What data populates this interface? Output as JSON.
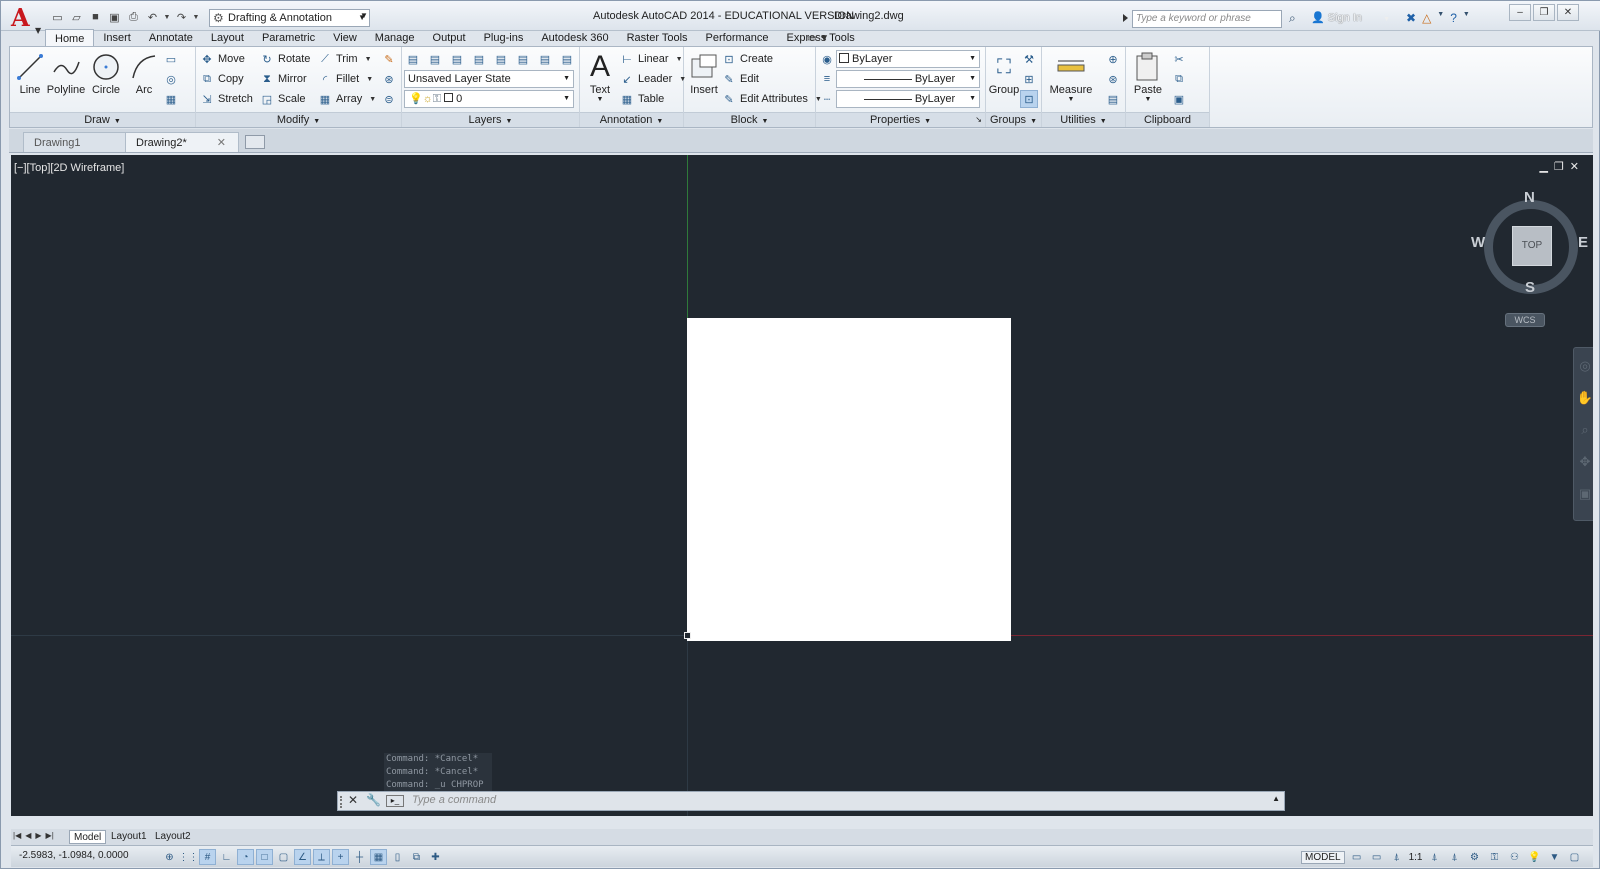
{
  "titlebar": {
    "title": "Autodesk AutoCAD 2014 - EDUCATIONAL VERSION",
    "filename": "Drawing2.dwg",
    "workspace": "Drafting & Annotation",
    "search_placeholder": "Type a keyword or phrase",
    "sign_in": "Sign In"
  },
  "ribbon_tabs": [
    "Home",
    "Insert",
    "Annotate",
    "Layout",
    "Parametric",
    "View",
    "Manage",
    "Output",
    "Plug-ins",
    "Autodesk 360",
    "Raster Tools",
    "Performance",
    "Express Tools"
  ],
  "active_tab": "Home",
  "panels": {
    "draw": {
      "title": "Draw",
      "buttons": [
        "Line",
        "Polyline",
        "Circle",
        "Arc"
      ]
    },
    "modify": {
      "title": "Modify",
      "rows": [
        [
          "Move",
          "Rotate",
          "Trim"
        ],
        [
          "Copy",
          "Mirror",
          "Fillet"
        ],
        [
          "Stretch",
          "Scale",
          "Array"
        ]
      ]
    },
    "layers": {
      "title": "Layers",
      "layer_state": "Unsaved Layer State",
      "current_layer": "0"
    },
    "annotation": {
      "title": "Annotation",
      "text_button": "Text",
      "items": [
        "Linear",
        "Leader",
        "Table"
      ]
    },
    "block": {
      "title": "Block",
      "insert_button": "Insert",
      "items": [
        "Create",
        "Edit",
        "Edit Attributes"
      ]
    },
    "properties": {
      "title": "Properties",
      "color": "ByLayer",
      "linetype": "ByLayer",
      "lineweight": "ByLayer"
    },
    "groups": {
      "title": "Groups",
      "button": "Group"
    },
    "utilities": {
      "title": "Utilities",
      "button": "Measure"
    },
    "clipboard": {
      "title": "Clipboard",
      "button": "Paste"
    }
  },
  "doc_tabs": [
    "Drawing1",
    "Drawing2*"
  ],
  "active_doc": "Drawing2*",
  "viewport": {
    "label": "[−][Top][2D Wireframe]",
    "viewcube": {
      "face": "TOP",
      "n": "N",
      "s": "S",
      "e": "E",
      "w": "W",
      "wcs": "WCS"
    }
  },
  "command": {
    "history": [
      "Command: *Cancel*",
      "Command: *Cancel*",
      "Command: _u CHPROP"
    ],
    "placeholder": "Type a command"
  },
  "layout_tabs": [
    "Model",
    "Layout1",
    "Layout2"
  ],
  "status": {
    "coordinates": "-2.5983, -1.0984, 0.0000",
    "model": "MODEL",
    "scale": "1:1"
  },
  "colors": {
    "viewport_bg": "#212830",
    "y_axis": "#2f7a3a",
    "x_axis": "#7a2633",
    "logo": "#c8171d"
  }
}
